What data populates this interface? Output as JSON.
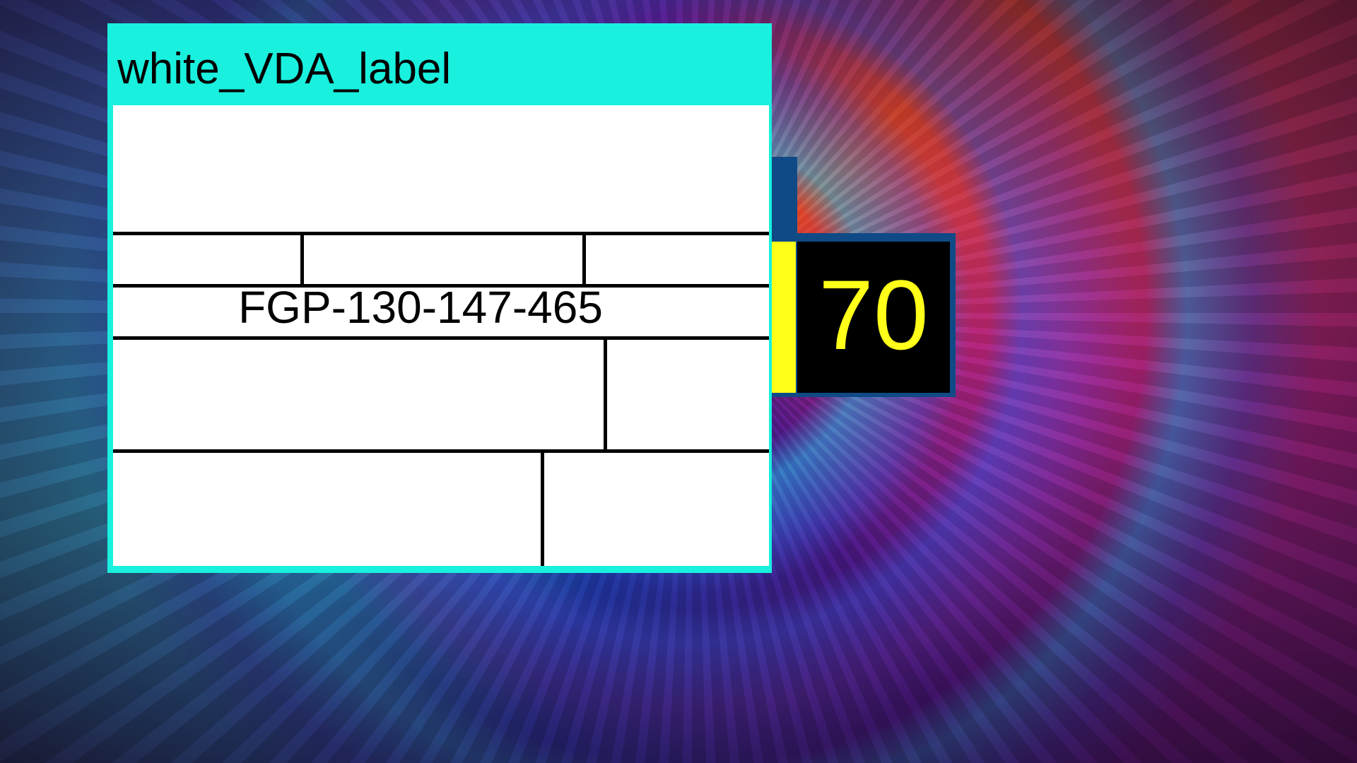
{
  "label": {
    "title": "white_VDA_label",
    "code": "FGP-130-147-465"
  },
  "counter": {
    "value": "70"
  },
  "colors": {
    "label_frame": "#19f0de",
    "counter_accent": "#ffff1a",
    "counter_text": "#ffff1a",
    "counter_frame": "#0f4a86"
  }
}
